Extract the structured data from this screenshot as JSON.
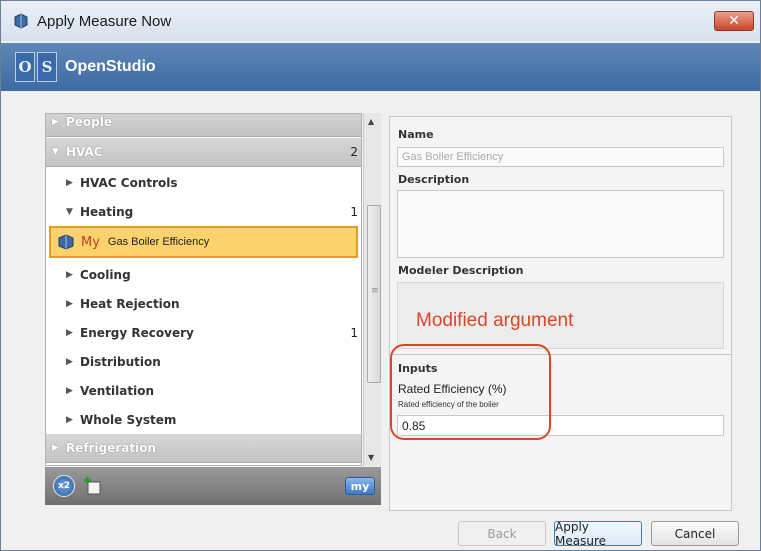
{
  "window": {
    "title": "Apply Measure Now",
    "close_label": "✕"
  },
  "banner": {
    "logo_letters": [
      "O",
      "S"
    ],
    "title": "OpenStudio"
  },
  "tree": {
    "rows": [
      {
        "label": "People",
        "level": 0,
        "count": ""
      },
      {
        "label": "HVAC",
        "level": 0,
        "count": "2"
      },
      {
        "label": "HVAC Controls",
        "level": 1,
        "count": ""
      },
      {
        "label": "Heating",
        "level": 1,
        "count": "1"
      },
      {
        "label": "Cooling",
        "level": 1,
        "count": ""
      },
      {
        "label": "Heat Rejection",
        "level": 1,
        "count": ""
      },
      {
        "label": "Energy Recovery",
        "level": 1,
        "count": "1"
      },
      {
        "label": "Distribution",
        "level": 1,
        "count": ""
      },
      {
        "label": "Ventilation",
        "level": 1,
        "count": ""
      },
      {
        "label": "Whole System",
        "level": 1,
        "count": ""
      },
      {
        "label": "Refrigeration",
        "level": 0,
        "count": ""
      }
    ],
    "selected": {
      "tag": "My",
      "name": "Gas Boiler Efficiency"
    },
    "toolbar": {
      "bcl_label": "x2",
      "my_label": "my"
    }
  },
  "details": {
    "name_label": "Name",
    "name_value": "Gas Boiler Efficiency",
    "description_label": "Description",
    "modeler_description_label": "Modeler Description",
    "annotation": "Modified argument",
    "inputs_label": "Inputs",
    "argument_label": "Rated Efficiency (%)",
    "argument_description": "Rated efficiency of the boiler",
    "argument_value": "0.85"
  },
  "buttons": {
    "back": "Back",
    "apply": "Apply Measure",
    "cancel": "Cancel"
  },
  "colors": {
    "highlight": "#d7472a",
    "selected_bg": "#fbd26b",
    "banner": "#4a76ad"
  }
}
